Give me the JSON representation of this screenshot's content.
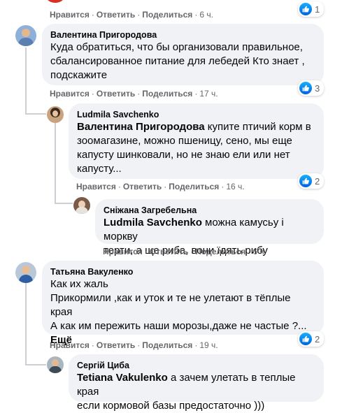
{
  "actions": {
    "like": "Нравится",
    "reply": "Ответить",
    "share": "Поделиться",
    "sep": "·"
  },
  "icons": {
    "like": "thumbs-up-icon",
    "like_color": "#1877f2"
  },
  "comments": [
    {
      "time": "6 ч.",
      "likes": "1"
    },
    {
      "author": "Валентина Пригородова",
      "lines": [
        "Куда обратиться, что бы организовали правильное,",
        "сбалансированное питание для лебедей Кто знает ,",
        "подскажите"
      ],
      "time": "17 ч.",
      "likes": "3"
    },
    {
      "author": "Ludmila Savchenko",
      "mention": "Валентина Пригородова",
      "first_line_rest": " купите птичий корм в",
      "lines": [
        "зоомагазине, можно пшеницу, сено, мы еще",
        "капусту шинковали, но не знаю ели или нет",
        "капусту..."
      ],
      "time": "16 ч.",
      "likes": "2"
    },
    {
      "author": "Сніжана Загребельна",
      "mention": "Ludmila Savchenko",
      "first_line_rest": " можна камусьу і моркву",
      "lines": [
        "терти, а ще риба, вони їдять рибу"
      ],
      "time": "6 ч."
    },
    {
      "author": "Татьяна Вакуленко",
      "lines": [
        "Как их жаль",
        "Прикормили ,как и уток и те не улетают в тёплые края",
        "А как им пережить наши морозы,даже не частые ?..."
      ],
      "more": "Ещё",
      "time": "19 ч.",
      "likes": "2"
    },
    {
      "author": "Сергій Циба",
      "mention": "Tetiana Vakulenko",
      "first_line_rest": " а зачем улетать в теплые края",
      "lines": [
        "если кормовой базы предостаточно )))"
      ]
    }
  ]
}
